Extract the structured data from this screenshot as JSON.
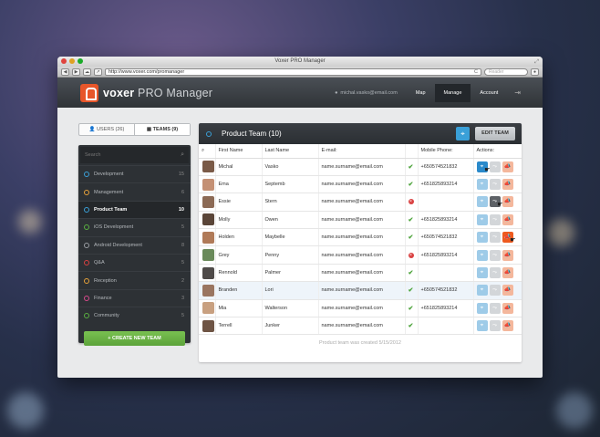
{
  "window": {
    "title": "Voxer PRO Manager",
    "url": "http://www.voxer.com/promanager",
    "search_placeholder": "Reader"
  },
  "header": {
    "brand_bold": "voxer",
    "brand_light": "PRO Manager",
    "user_email": "michal.vasko@email.com",
    "nav": [
      "Map",
      "Manage",
      "Account"
    ]
  },
  "segment": {
    "users": "USERS (26)",
    "teams": "TEAMS (9)"
  },
  "sidebar": {
    "search_placeholder": "Search",
    "items": [
      {
        "name": "Development",
        "count": "15",
        "color": "#3aa0d8"
      },
      {
        "name": "Management",
        "count": "6",
        "color": "#e8a23a"
      },
      {
        "name": "Product Team",
        "count": "10",
        "color": "#3aa0d8",
        "active": true
      },
      {
        "name": "iOS Development",
        "count": "5",
        "color": "#5ab041"
      },
      {
        "name": "Android Development",
        "count": "8",
        "color": "#9a9ea3"
      },
      {
        "name": "Q&A",
        "count": "5",
        "color": "#d94040"
      },
      {
        "name": "Reception",
        "count": "2",
        "color": "#e8a23a"
      },
      {
        "name": "Finance",
        "count": "3",
        "color": "#d94a8c"
      },
      {
        "name": "Community",
        "count": "5",
        "color": "#5ab041"
      }
    ],
    "create_label": "+ CREATE NEW TEAM"
  },
  "main": {
    "title": "Product Team (10)",
    "edit_label": "EDIT TEAM",
    "columns": [
      "First Name",
      "Last Name",
      "E-mail:",
      "Mobile Phone:",
      "Actions:"
    ],
    "rows": [
      {
        "first": "Michal",
        "last": "Vasko",
        "email": "name.surname@email.com",
        "ok": true,
        "phone": "+650574521832",
        "avatar": "#7a5a47"
      },
      {
        "first": "Ema",
        "last": "Septemb",
        "email": "name.surname@email.com",
        "ok": true,
        "phone": "+651825893214",
        "avatar": "#c49074"
      },
      {
        "first": "Essie",
        "last": "Stern",
        "email": "name.surname@email.com",
        "ok": false,
        "phone": "",
        "avatar": "#8c6a55"
      },
      {
        "first": "Molly",
        "last": "Owen",
        "email": "name.surname@email.com",
        "ok": true,
        "phone": "+651825893214",
        "avatar": "#5a4538"
      },
      {
        "first": "Holden",
        "last": "Maybelle",
        "email": "name.surname@email.com",
        "ok": true,
        "phone": "+650574521832",
        "avatar": "#b07a58"
      },
      {
        "first": "Grey",
        "last": "Penny",
        "email": "name.surname@email.com",
        "ok": false,
        "phone": "+651825893214",
        "avatar": "#6a8a5a"
      },
      {
        "first": "Rennold",
        "last": "Palmer",
        "email": "name.surname@email.com",
        "ok": true,
        "phone": "",
        "avatar": "#4e4a48"
      },
      {
        "first": "Branden",
        "last": "Lori",
        "email": "name.surname@email.com",
        "ok": true,
        "phone": "+650574521832",
        "avatar": "#9a7560"
      },
      {
        "first": "Mia",
        "last": "Walterson",
        "email": "name.surname@email.com",
        "ok": true,
        "phone": "+651825893214",
        "avatar": "#c8a080"
      },
      {
        "first": "Terrell",
        "last": "Junker",
        "email": "name.surname@email.com",
        "ok": true,
        "phone": "",
        "avatar": "#6e5444"
      }
    ],
    "footer": "Product team was created 5/15/2012"
  }
}
